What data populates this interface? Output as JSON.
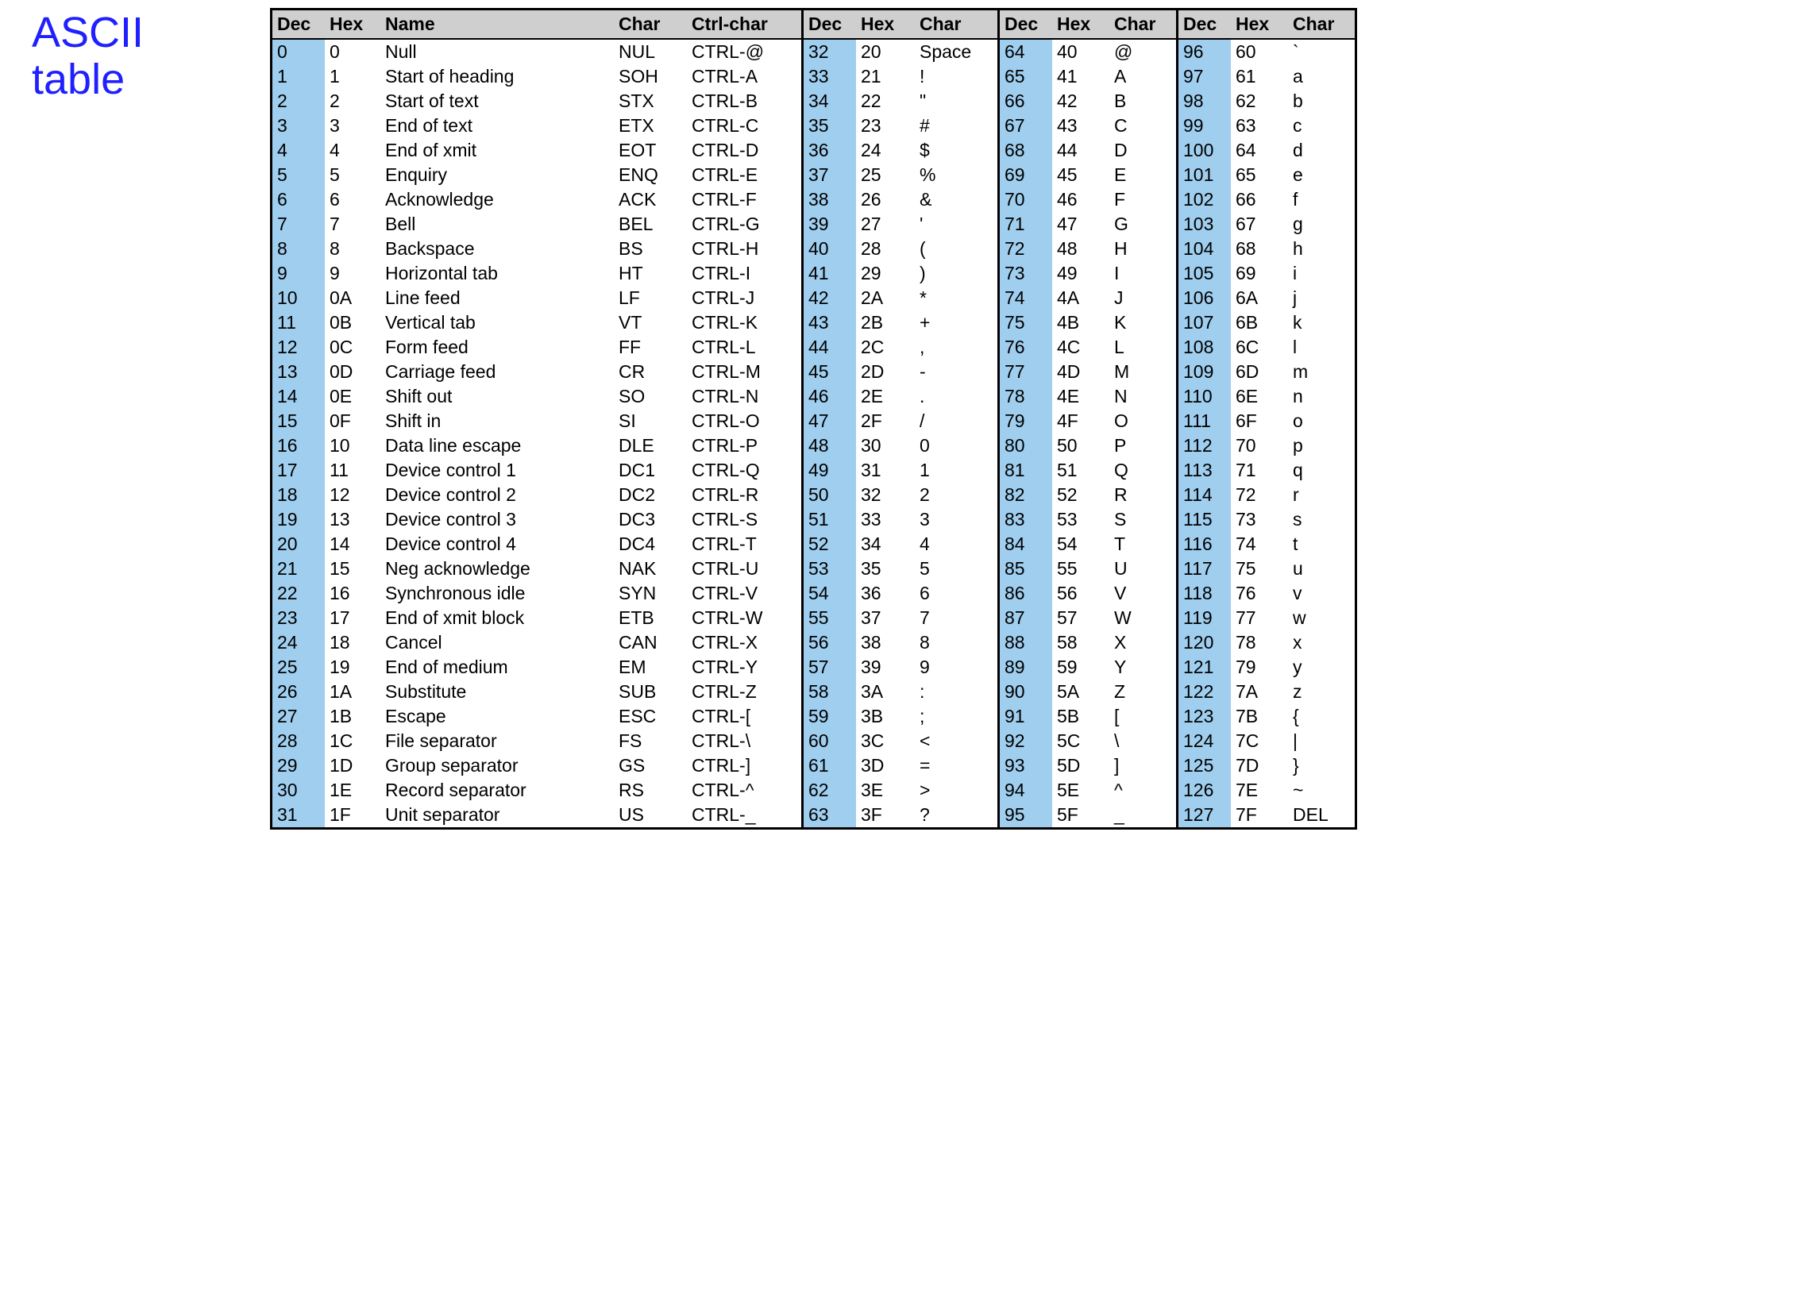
{
  "title_line1": "ASCII",
  "title_line2": "table",
  "headers": {
    "dec": "Dec",
    "hex": "Hex",
    "name": "Name",
    "char": "Char",
    "ctrl": "Ctrl-char"
  },
  "groupA": [
    {
      "dec": "0",
      "hex": "0",
      "name": "Null",
      "char": "NUL",
      "ctrl": "CTRL-@"
    },
    {
      "dec": "1",
      "hex": "1",
      "name": "Start of heading",
      "char": "SOH",
      "ctrl": "CTRL-A"
    },
    {
      "dec": "2",
      "hex": "2",
      "name": "Start of text",
      "char": "STX",
      "ctrl": "CTRL-B"
    },
    {
      "dec": "3",
      "hex": "3",
      "name": "End of text",
      "char": "ETX",
      "ctrl": "CTRL-C"
    },
    {
      "dec": "4",
      "hex": "4",
      "name": "End of xmit",
      "char": "EOT",
      "ctrl": "CTRL-D"
    },
    {
      "dec": "5",
      "hex": "5",
      "name": "Enquiry",
      "char": "ENQ",
      "ctrl": "CTRL-E"
    },
    {
      "dec": "6",
      "hex": "6",
      "name": "Acknowledge",
      "char": "ACK",
      "ctrl": "CTRL-F"
    },
    {
      "dec": "7",
      "hex": "7",
      "name": "Bell",
      "char": "BEL",
      "ctrl": "CTRL-G"
    },
    {
      "dec": "8",
      "hex": "8",
      "name": "Backspace",
      "char": "BS",
      "ctrl": "CTRL-H"
    },
    {
      "dec": "9",
      "hex": "9",
      "name": "Horizontal tab",
      "char": "HT",
      "ctrl": "CTRL-I"
    },
    {
      "dec": "10",
      "hex": "0A",
      "name": "Line feed",
      "char": "LF",
      "ctrl": "CTRL-J"
    },
    {
      "dec": "11",
      "hex": "0B",
      "name": "Vertical tab",
      "char": "VT",
      "ctrl": "CTRL-K"
    },
    {
      "dec": "12",
      "hex": "0C",
      "name": "Form feed",
      "char": "FF",
      "ctrl": "CTRL-L"
    },
    {
      "dec": "13",
      "hex": "0D",
      "name": "Carriage feed",
      "char": "CR",
      "ctrl": "CTRL-M"
    },
    {
      "dec": "14",
      "hex": "0E",
      "name": "Shift out",
      "char": "SO",
      "ctrl": "CTRL-N"
    },
    {
      "dec": "15",
      "hex": "0F",
      "name": "Shift in",
      "char": "SI",
      "ctrl": "CTRL-O"
    },
    {
      "dec": "16",
      "hex": "10",
      "name": "Data line escape",
      "char": "DLE",
      "ctrl": "CTRL-P"
    },
    {
      "dec": "17",
      "hex": "11",
      "name": "Device control 1",
      "char": "DC1",
      "ctrl": "CTRL-Q"
    },
    {
      "dec": "18",
      "hex": "12",
      "name": "Device control 2",
      "char": "DC2",
      "ctrl": "CTRL-R"
    },
    {
      "dec": "19",
      "hex": "13",
      "name": "Device control 3",
      "char": "DC3",
      "ctrl": "CTRL-S"
    },
    {
      "dec": "20",
      "hex": "14",
      "name": "Device control 4",
      "char": "DC4",
      "ctrl": "CTRL-T"
    },
    {
      "dec": "21",
      "hex": "15",
      "name": "Neg acknowledge",
      "char": "NAK",
      "ctrl": "CTRL-U"
    },
    {
      "dec": "22",
      "hex": "16",
      "name": "Synchronous idle",
      "char": "SYN",
      "ctrl": "CTRL-V"
    },
    {
      "dec": "23",
      "hex": "17",
      "name": "End of xmit block",
      "char": "ETB",
      "ctrl": "CTRL-W"
    },
    {
      "dec": "24",
      "hex": "18",
      "name": "Cancel",
      "char": "CAN",
      "ctrl": "CTRL-X"
    },
    {
      "dec": "25",
      "hex": "19",
      "name": "End of medium",
      "char": "EM",
      "ctrl": "CTRL-Y"
    },
    {
      "dec": "26",
      "hex": "1A",
      "name": "Substitute",
      "char": "SUB",
      "ctrl": "CTRL-Z"
    },
    {
      "dec": "27",
      "hex": "1B",
      "name": "Escape",
      "char": "ESC",
      "ctrl": "CTRL-["
    },
    {
      "dec": "28",
      "hex": "1C",
      "name": "File separator",
      "char": "FS",
      "ctrl": "CTRL-\\"
    },
    {
      "dec": "29",
      "hex": "1D",
      "name": "Group separator",
      "char": "GS",
      "ctrl": "CTRL-]"
    },
    {
      "dec": "30",
      "hex": "1E",
      "name": "Record separator",
      "char": "RS",
      "ctrl": "CTRL-^"
    },
    {
      "dec": "31",
      "hex": "1F",
      "name": "Unit separator",
      "char": "US",
      "ctrl": "CTRL-_"
    }
  ],
  "groupB": [
    {
      "dec": "32",
      "hex": "20",
      "char": "Space"
    },
    {
      "dec": "33",
      "hex": "21",
      "char": "!"
    },
    {
      "dec": "34",
      "hex": "22",
      "char": "\""
    },
    {
      "dec": "35",
      "hex": "23",
      "char": "#"
    },
    {
      "dec": "36",
      "hex": "24",
      "char": "$"
    },
    {
      "dec": "37",
      "hex": "25",
      "char": "%"
    },
    {
      "dec": "38",
      "hex": "26",
      "char": "&"
    },
    {
      "dec": "39",
      "hex": "27",
      "char": "'"
    },
    {
      "dec": "40",
      "hex": "28",
      "char": "("
    },
    {
      "dec": "41",
      "hex": "29",
      "char": ")"
    },
    {
      "dec": "42",
      "hex": "2A",
      "char": "*"
    },
    {
      "dec": "43",
      "hex": "2B",
      "char": "+"
    },
    {
      "dec": "44",
      "hex": "2C",
      "char": ","
    },
    {
      "dec": "45",
      "hex": "2D",
      "char": "-"
    },
    {
      "dec": "46",
      "hex": "2E",
      "char": "."
    },
    {
      "dec": "47",
      "hex": "2F",
      "char": "/"
    },
    {
      "dec": "48",
      "hex": "30",
      "char": "0"
    },
    {
      "dec": "49",
      "hex": "31",
      "char": "1"
    },
    {
      "dec": "50",
      "hex": "32",
      "char": "2"
    },
    {
      "dec": "51",
      "hex": "33",
      "char": "3"
    },
    {
      "dec": "52",
      "hex": "34",
      "char": "4"
    },
    {
      "dec": "53",
      "hex": "35",
      "char": "5"
    },
    {
      "dec": "54",
      "hex": "36",
      "char": "6"
    },
    {
      "dec": "55",
      "hex": "37",
      "char": "7"
    },
    {
      "dec": "56",
      "hex": "38",
      "char": "8"
    },
    {
      "dec": "57",
      "hex": "39",
      "char": "9"
    },
    {
      "dec": "58",
      "hex": "3A",
      "char": ":"
    },
    {
      "dec": "59",
      "hex": "3B",
      "char": ";"
    },
    {
      "dec": "60",
      "hex": "3C",
      "char": "<"
    },
    {
      "dec": "61",
      "hex": "3D",
      "char": "="
    },
    {
      "dec": "62",
      "hex": "3E",
      "char": ">"
    },
    {
      "dec": "63",
      "hex": "3F",
      "char": "?"
    }
  ],
  "groupC": [
    {
      "dec": "64",
      "hex": "40",
      "char": "@"
    },
    {
      "dec": "65",
      "hex": "41",
      "char": "A"
    },
    {
      "dec": "66",
      "hex": "42",
      "char": "B"
    },
    {
      "dec": "67",
      "hex": "43",
      "char": "C"
    },
    {
      "dec": "68",
      "hex": "44",
      "char": "D"
    },
    {
      "dec": "69",
      "hex": "45",
      "char": "E"
    },
    {
      "dec": "70",
      "hex": "46",
      "char": "F"
    },
    {
      "dec": "71",
      "hex": "47",
      "char": "G"
    },
    {
      "dec": "72",
      "hex": "48",
      "char": "H"
    },
    {
      "dec": "73",
      "hex": "49",
      "char": "I"
    },
    {
      "dec": "74",
      "hex": "4A",
      "char": "J"
    },
    {
      "dec": "75",
      "hex": "4B",
      "char": "K"
    },
    {
      "dec": "76",
      "hex": "4C",
      "char": "L"
    },
    {
      "dec": "77",
      "hex": "4D",
      "char": "M"
    },
    {
      "dec": "78",
      "hex": "4E",
      "char": "N"
    },
    {
      "dec": "79",
      "hex": "4F",
      "char": "O"
    },
    {
      "dec": "80",
      "hex": "50",
      "char": "P"
    },
    {
      "dec": "81",
      "hex": "51",
      "char": "Q"
    },
    {
      "dec": "82",
      "hex": "52",
      "char": "R"
    },
    {
      "dec": "83",
      "hex": "53",
      "char": "S"
    },
    {
      "dec": "84",
      "hex": "54",
      "char": "T"
    },
    {
      "dec": "85",
      "hex": "55",
      "char": "U"
    },
    {
      "dec": "86",
      "hex": "56",
      "char": "V"
    },
    {
      "dec": "87",
      "hex": "57",
      "char": "W"
    },
    {
      "dec": "88",
      "hex": "58",
      "char": "X"
    },
    {
      "dec": "89",
      "hex": "59",
      "char": "Y"
    },
    {
      "dec": "90",
      "hex": "5A",
      "char": "Z"
    },
    {
      "dec": "91",
      "hex": "5B",
      "char": "["
    },
    {
      "dec": "92",
      "hex": "5C",
      "char": "\\"
    },
    {
      "dec": "93",
      "hex": "5D",
      "char": "]"
    },
    {
      "dec": "94",
      "hex": "5E",
      "char": "^"
    },
    {
      "dec": "95",
      "hex": "5F",
      "char": "_"
    }
  ],
  "groupD": [
    {
      "dec": "96",
      "hex": "60",
      "char": "`"
    },
    {
      "dec": "97",
      "hex": "61",
      "char": "a"
    },
    {
      "dec": "98",
      "hex": "62",
      "char": "b"
    },
    {
      "dec": "99",
      "hex": "63",
      "char": "c"
    },
    {
      "dec": "100",
      "hex": "64",
      "char": "d"
    },
    {
      "dec": "101",
      "hex": "65",
      "char": "e"
    },
    {
      "dec": "102",
      "hex": "66",
      "char": "f"
    },
    {
      "dec": "103",
      "hex": "67",
      "char": "g"
    },
    {
      "dec": "104",
      "hex": "68",
      "char": "h"
    },
    {
      "dec": "105",
      "hex": "69",
      "char": "i"
    },
    {
      "dec": "106",
      "hex": "6A",
      "char": "j"
    },
    {
      "dec": "107",
      "hex": "6B",
      "char": "k"
    },
    {
      "dec": "108",
      "hex": "6C",
      "char": "l"
    },
    {
      "dec": "109",
      "hex": "6D",
      "char": "m"
    },
    {
      "dec": "110",
      "hex": "6E",
      "char": "n"
    },
    {
      "dec": "111",
      "hex": "6F",
      "char": "o"
    },
    {
      "dec": "112",
      "hex": "70",
      "char": "p"
    },
    {
      "dec": "113",
      "hex": "71",
      "char": "q"
    },
    {
      "dec": "114",
      "hex": "72",
      "char": "r"
    },
    {
      "dec": "115",
      "hex": "73",
      "char": "s"
    },
    {
      "dec": "116",
      "hex": "74",
      "char": "t"
    },
    {
      "dec": "117",
      "hex": "75",
      "char": "u"
    },
    {
      "dec": "118",
      "hex": "76",
      "char": "v"
    },
    {
      "dec": "119",
      "hex": "77",
      "char": "w"
    },
    {
      "dec": "120",
      "hex": "78",
      "char": "x"
    },
    {
      "dec": "121",
      "hex": "79",
      "char": "y"
    },
    {
      "dec": "122",
      "hex": "7A",
      "char": "z"
    },
    {
      "dec": "123",
      "hex": "7B",
      "char": "{"
    },
    {
      "dec": "124",
      "hex": "7C",
      "char": "|"
    },
    {
      "dec": "125",
      "hex": "7D",
      "char": "}"
    },
    {
      "dec": "126",
      "hex": "7E",
      "char": "~"
    },
    {
      "dec": "127",
      "hex": "7F",
      "char": "DEL"
    }
  ]
}
